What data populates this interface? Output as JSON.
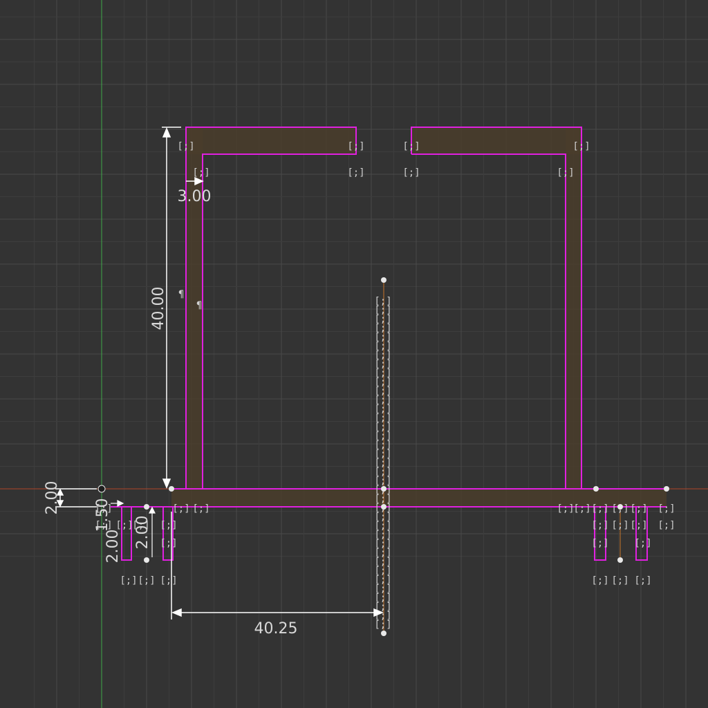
{
  "app": {
    "view": "sketch-canvas"
  },
  "colors": {
    "background": "#333333",
    "grid_minor": "#3d3d3d",
    "grid_major": "#4a4a4a",
    "x_axis": "#b0442a",
    "y_axis": "#3fa94a",
    "profile_fill": "#4a3d2c",
    "sketch_line": "#e020e0",
    "dimension": "#ffffff",
    "point": "#e8e8e8",
    "construction": "#c8762a"
  },
  "dimensions": {
    "height": "40.00",
    "wall": "3.00",
    "offset": "2.00",
    "width": "40.25",
    "small_a": "2.00",
    "small_b": "1.50",
    "small_c": "2.00"
  },
  "icons": {
    "constraint": "coincident-constraint-icon",
    "parallel": "parallel-constraint-icon",
    "origin": "origin-point-icon"
  }
}
